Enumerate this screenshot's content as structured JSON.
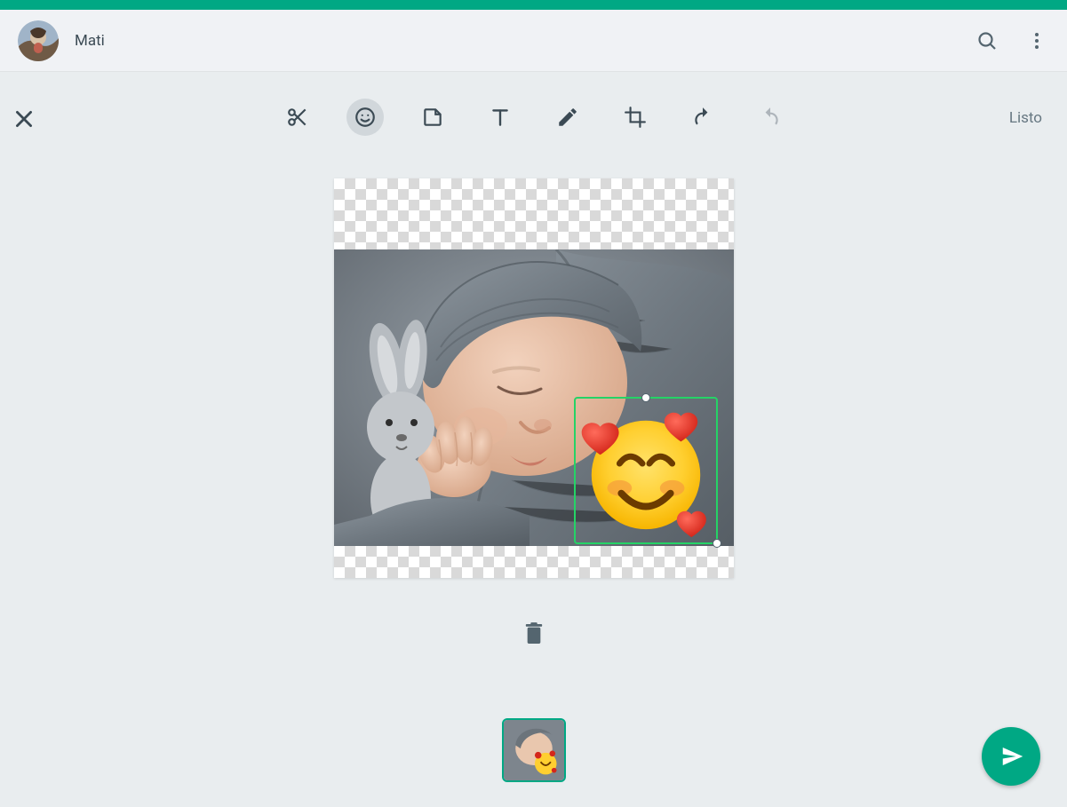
{
  "app": {
    "accent_color": "#00a884",
    "selection_color": "#25d366"
  },
  "header": {
    "contact_name": "Mati"
  },
  "editor": {
    "done_label": "Listo",
    "active_tool": "emoji",
    "sticker_emoji": "smiling-face-with-hearts",
    "thumbnail_count": 1,
    "selected_thumbnail_index": 0
  }
}
